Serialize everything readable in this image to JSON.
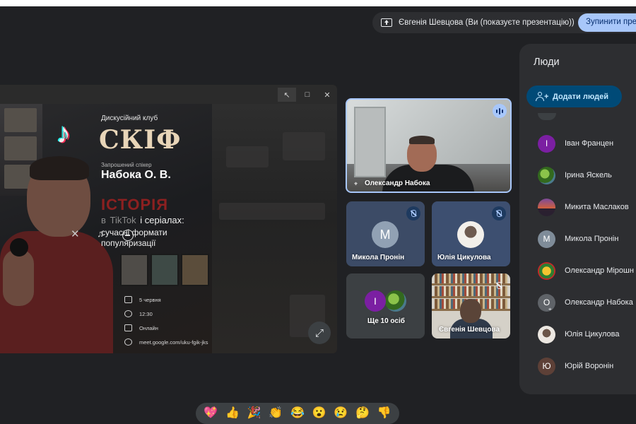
{
  "presenting": {
    "banner_text": "Євгенія Шевцова (Ви (показуєте презентацію))",
    "stop_button": "Зупинити пре"
  },
  "shared_window": {
    "icons": [
      "cursor-icon",
      "maximize-icon",
      "close-icon"
    ],
    "poster": {
      "club": "Дискусійний клуб",
      "title": "СКІФ",
      "speaker_label": "Запрошений спікер",
      "speaker": "Набока О. В.",
      "history": "ІСТОРІЯ",
      "line_prefix": "в",
      "line_tiktok": "TikTok",
      "line_suffix": "і серіалах:",
      "subtitle": "сучасні формати популяризації",
      "date": "5 червня",
      "time": "12:30",
      "format": "Онлайн",
      "link": "meet.google.com/uku-fgik-jks"
    }
  },
  "tiles": {
    "main": {
      "name": "Олександр Набока"
    },
    "mykola": {
      "name": "Микола Пронін",
      "initial": "M"
    },
    "yulia": {
      "name": "Юлія Цикулова"
    },
    "more": {
      "label": "Ще 10 осіб",
      "initial": "I"
    },
    "self": {
      "name": "Євгенія Шевцова"
    }
  },
  "people_panel": {
    "title": "Люди",
    "add_button": "Додати людей",
    "participants": [
      {
        "name": "Іван Францен",
        "initial": "I",
        "avatar": "purple"
      },
      {
        "name": "Ірина Яскель",
        "initial": "",
        "avatar": "leaf"
      },
      {
        "name": "Микита Маслаков",
        "initial": "",
        "avatar": "sunset"
      },
      {
        "name": "Микола Пронін",
        "initial": "M",
        "avatar": "slate"
      },
      {
        "name": "Олександр Мірошн",
        "initial": "",
        "avatar": "emblem"
      },
      {
        "name": "Олександр Набока",
        "initial": "О",
        "avatar": "gray"
      },
      {
        "name": "Юлія Цикулова",
        "initial": "",
        "avatar": "girl"
      },
      {
        "name": "Юрій Воронін",
        "initial": "Ю",
        "avatar": "brown"
      }
    ]
  },
  "reactions": [
    "💖",
    "👍",
    "🎉",
    "👏",
    "😂",
    "😮",
    "😢",
    "🤔",
    "👎"
  ],
  "colors": {
    "background": "#202124",
    "accent": "#a8c7fa",
    "panel": "#2d2e31",
    "add_button": "#004a77"
  }
}
